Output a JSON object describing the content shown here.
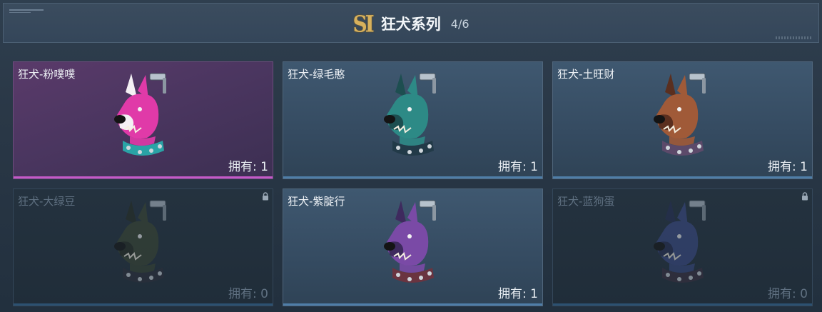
{
  "header": {
    "season_badge": "SI",
    "title": "狂犬系列",
    "progress": "4/6"
  },
  "cards": [
    {
      "name": "狂犬-粉噗噗",
      "owned": "拥有: 1",
      "locked": false,
      "theme": "pink",
      "colors": {
        "skin": "#e03aa8",
        "accent": "#f4f0f4",
        "collar": "#2aa3a6",
        "bar": "#c45ac8"
      }
    },
    {
      "name": "狂犬-绿毛憨",
      "owned": "拥有: 1",
      "locked": false,
      "theme": "blue",
      "colors": {
        "skin": "#2d8a86",
        "accent": "#1d4e50",
        "collar": "#223a48",
        "bar": "#4f7ea8"
      }
    },
    {
      "name": "狂犬-土旺财",
      "owned": "拥有: 1",
      "locked": false,
      "theme": "blue",
      "colors": {
        "skin": "#a05a38",
        "accent": "#5a2f1f",
        "collar": "#5c4a6a",
        "bar": "#4f7ea8"
      }
    },
    {
      "name": "狂犬-大绿豆",
      "owned": "拥有: 0",
      "locked": true,
      "theme": "locked",
      "colors": {
        "skin": "#3b4632",
        "accent": "#262d22",
        "collar": "#2d2f3a",
        "bar": "#2f5a80"
      }
    },
    {
      "name": "狂犬-紫腚行",
      "owned": "拥有: 1",
      "locked": false,
      "theme": "blue",
      "colors": {
        "skin": "#7a4aa6",
        "accent": "#3e2a5e",
        "collar": "#6a3440",
        "bar": "#4f7ea8"
      }
    },
    {
      "name": "狂犬-蓝狗蛋",
      "owned": "拥有: 0",
      "locked": true,
      "theme": "locked",
      "colors": {
        "skin": "#3b4a86",
        "accent": "#262e52",
        "collar": "#3a2f3f",
        "bar": "#2f5a80"
      }
    }
  ]
}
